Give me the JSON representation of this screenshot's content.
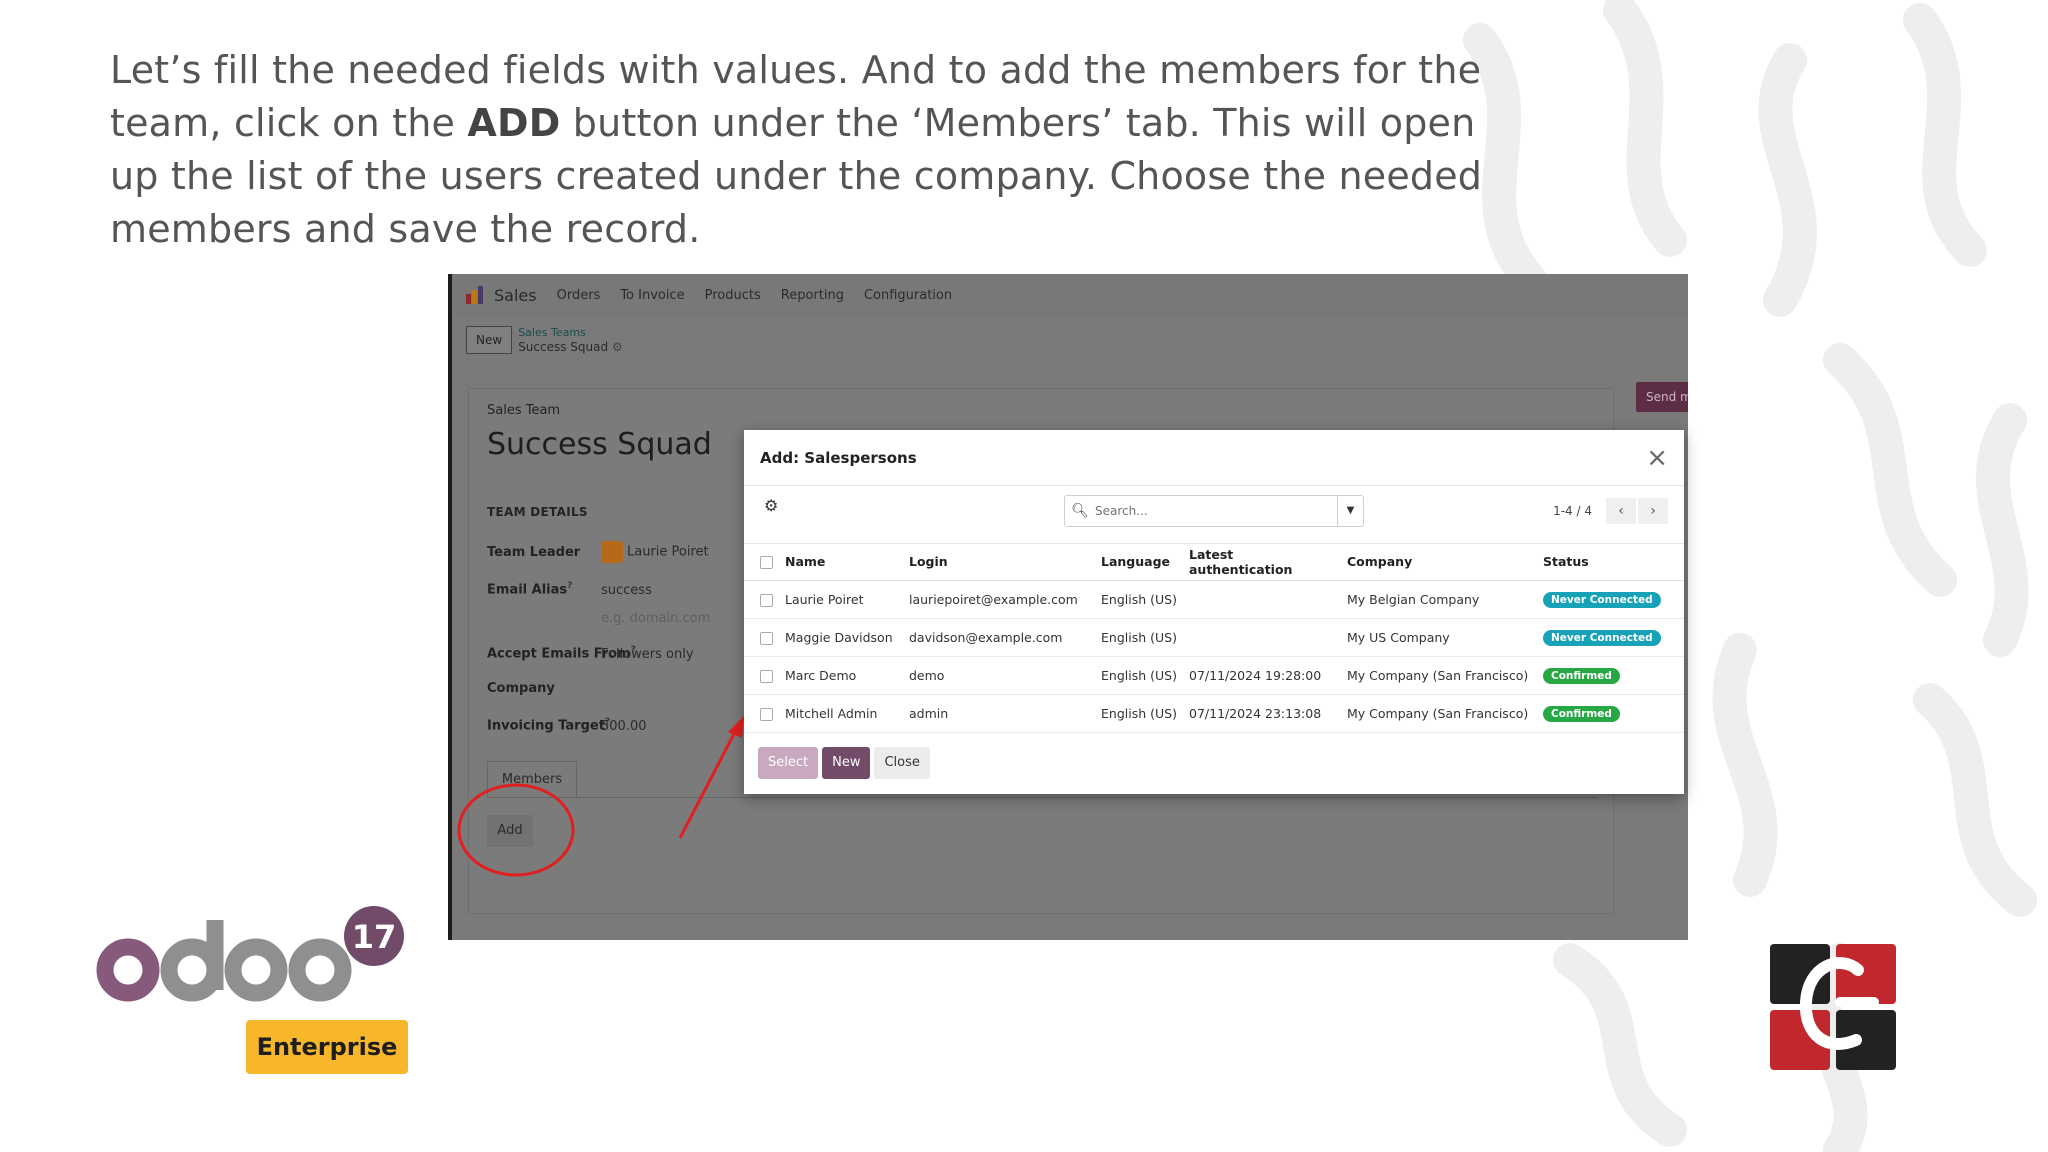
{
  "intro": {
    "part1": "Let’s fill the needed fields with values. And to add the members for the team, click on the ",
    "bold": "ADD",
    "part2": " button under the ‘Members’ tab. This will open up the list of the users created under the company. Choose the needed members and save the record."
  },
  "topbar": {
    "app": "Sales",
    "menus": [
      "Orders",
      "To Invoice",
      "Products",
      "Reporting",
      "Configuration"
    ]
  },
  "breadcrumb": {
    "new_label": "New",
    "parent": "Sales Teams",
    "current": "Success Squad"
  },
  "form": {
    "record_label": "Sales Team",
    "title": "Success Squad",
    "section": "TEAM DETAILS",
    "team_leader_label": "Team Leader",
    "team_leader_value": "Laurie Poiret",
    "email_alias_label": "Email Alias",
    "email_alias_value": "success",
    "email_alias_placeholder": "e.g. domain.com",
    "accept_emails_label": "Accept Emails From",
    "accept_emails_value": "Followers only",
    "company_label": "Company",
    "invoicing_target_label": "Invoicing Target",
    "invoicing_target_value": "500.00",
    "help_mark": "?",
    "tab_members": "Members",
    "add_button": "Add",
    "send_button": "Send m"
  },
  "dialog": {
    "title": "Add: Salespersons",
    "search_placeholder": "Search...",
    "pager": "1-4 / 4",
    "columns": [
      "Name",
      "Login",
      "Language",
      "Latest authentication",
      "Company",
      "Status"
    ],
    "rows": [
      {
        "name": "Laurie Poiret",
        "login": "lauriepoiret@example.com",
        "language": "English (US)",
        "auth": "",
        "company": "My Belgian Company",
        "status": "Never Connected",
        "status_kind": "never"
      },
      {
        "name": "Maggie Davidson",
        "login": "davidson@example.com",
        "language": "English (US)",
        "auth": "",
        "company": "My US Company",
        "status": "Never Connected",
        "status_kind": "never"
      },
      {
        "name": "Marc Demo",
        "login": "demo",
        "language": "English (US)",
        "auth": "07/11/2024 19:28:00",
        "company": "My Company (San Francisco)",
        "status": "Confirmed",
        "status_kind": "conf"
      },
      {
        "name": "Mitchell Admin",
        "login": "admin",
        "language": "English (US)",
        "auth": "07/11/2024 23:13:08",
        "company": "My Company (San Francisco)",
        "status": "Confirmed",
        "status_kind": "conf"
      }
    ],
    "buttons": {
      "select": "Select",
      "new": "New",
      "close": "Close"
    }
  },
  "logo": {
    "wordmark": "odoo",
    "version": "17",
    "edition": "Enterprise"
  },
  "colors": {
    "odoo_purple": "#714b67",
    "enterprise_yellow": "#f8b62b",
    "brand_red": "#c0282d"
  }
}
